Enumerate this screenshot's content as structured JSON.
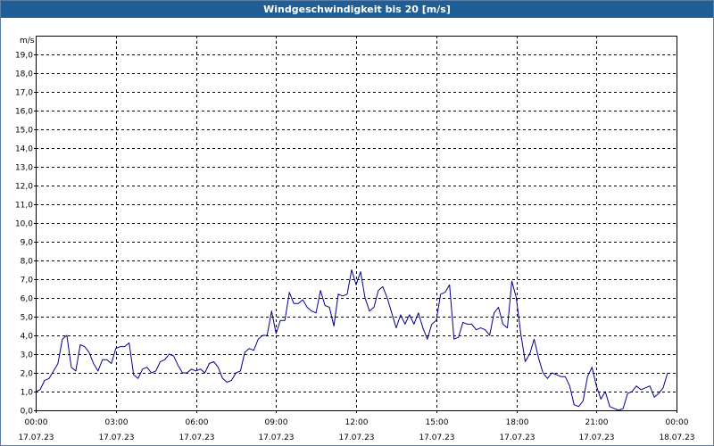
{
  "window": {
    "title": "Windgeschwindigkeit bis 20 [m/s]"
  },
  "chart_data": {
    "type": "line",
    "title": "Windgeschwindigkeit bis 20 [m/s]",
    "ylabel": "m/s",
    "xlabel": "",
    "ylim": [
      0,
      20
    ],
    "xlim_hours": [
      0,
      24
    ],
    "grid": true,
    "y_ticks": [
      "0,0",
      "1,0",
      "2,0",
      "3,0",
      "4,0",
      "5,0",
      "6,0",
      "7,0",
      "8,0",
      "9,0",
      "10,0",
      "11,0",
      "12,0",
      "13,0",
      "14,0",
      "15,0",
      "16,0",
      "17,0",
      "18,0",
      "19,0"
    ],
    "x_ticks": [
      {
        "time": "00:00",
        "date": "17.07.23"
      },
      {
        "time": "03:00",
        "date": "17.07.23"
      },
      {
        "time": "06:00",
        "date": "17.07.23"
      },
      {
        "time": "09:00",
        "date": "17.07.23"
      },
      {
        "time": "12:00",
        "date": "17.07.23"
      },
      {
        "time": "15:00",
        "date": "17.07.23"
      },
      {
        "time": "18:00",
        "date": "17.07.23"
      },
      {
        "time": "21:00",
        "date": "17.07.23"
      },
      {
        "time": "00:00",
        "date": "18.07.23"
      }
    ],
    "series": [
      {
        "color": "#00008b",
        "x_hours": [
          0,
          0.167,
          0.333,
          0.5,
          0.667,
          0.833,
          1,
          1.167,
          1.333,
          1.5,
          1.667,
          1.833,
          2,
          2.167,
          2.333,
          2.5,
          2.667,
          2.833,
          3,
          3.167,
          3.333,
          3.5,
          3.667,
          3.833,
          4,
          4.167,
          4.333,
          4.5,
          4.667,
          4.833,
          5,
          5.167,
          5.333,
          5.5,
          5.667,
          5.833,
          6,
          6.167,
          6.333,
          6.5,
          6.667,
          6.833,
          7,
          7.167,
          7.333,
          7.5,
          7.667,
          7.833,
          8,
          8.167,
          8.333,
          8.5,
          8.667,
          8.833,
          9,
          9.167,
          9.333,
          9.5,
          9.667,
          9.833,
          10,
          10.167,
          10.333,
          10.5,
          10.667,
          10.833,
          11,
          11.167,
          11.333,
          11.5,
          11.667,
          11.833,
          12,
          12.167,
          12.333,
          12.5,
          12.667,
          12.833,
          13,
          13.167,
          13.333,
          13.5,
          13.667,
          13.833,
          14,
          14.167,
          14.333,
          14.5,
          14.667,
          14.833,
          15,
          15.167,
          15.333,
          15.5,
          15.667,
          15.833,
          16,
          16.167,
          16.333,
          16.5,
          16.667,
          16.833,
          17,
          17.167,
          17.333,
          17.5,
          17.667,
          17.833,
          18,
          18.167,
          18.333,
          18.5,
          18.667,
          18.833,
          19,
          19.167,
          19.333,
          19.5,
          19.667,
          19.833,
          20,
          20.167,
          20.333,
          20.5,
          20.667,
          20.833,
          21,
          21.167,
          21.333,
          21.5,
          21.667,
          21.833,
          22,
          22.167,
          22.333,
          22.5,
          22.667,
          22.833,
          23,
          23.167,
          23.333,
          23.5,
          23.667,
          23.833
        ],
        "values": [
          1.0,
          1.1,
          1.6,
          1.7,
          2.1,
          2.5,
          3.8,
          4.0,
          2.3,
          2.1,
          3.5,
          3.4,
          3.1,
          2.5,
          2.1,
          2.7,
          2.7,
          2.5,
          3.3,
          3.4,
          3.4,
          3.6,
          1.9,
          1.7,
          2.2,
          2.3,
          2.0,
          2.1,
          2.6,
          2.7,
          3.0,
          2.9,
          2.4,
          2.0,
          2.0,
          2.2,
          2.1,
          2.2,
          2.0,
          2.5,
          2.6,
          2.3,
          1.7,
          1.5,
          1.6,
          2.0,
          2.1,
          3.1,
          3.3,
          3.2,
          3.8,
          4.0,
          4.0,
          5.3,
          4.1,
          4.8,
          4.8,
          6.3,
          5.7,
          5.7,
          5.9,
          5.5,
          5.3,
          5.2,
          6.4,
          5.6,
          5.5,
          4.5,
          6.2,
          6.1,
          6.2,
          7.5,
          6.7,
          7.4,
          6.0,
          5.3,
          5.5,
          6.4,
          6.6,
          6.0,
          5.2,
          4.4,
          5.1,
          4.6,
          5.1,
          4.6,
          5.2,
          4.4,
          3.8,
          4.6,
          4.8,
          6.2,
          6.3,
          6.7,
          3.8,
          3.9,
          4.7,
          4.6,
          4.6,
          4.3,
          4.4,
          4.3,
          4.0,
          5.2,
          5.5,
          4.6,
          4.4,
          6.9,
          6.0,
          4.1,
          2.6,
          3.0,
          3.8,
          2.8,
          2.0,
          1.7,
          2.0,
          1.9,
          1.8,
          1.8,
          1.3,
          0.3,
          0.2,
          0.5,
          1.8,
          2.3,
          1.3,
          0.6,
          1.0,
          0.2,
          0.1,
          0.0,
          0.1,
          0.9,
          1.0,
          1.3,
          1.1,
          1.2,
          1.3,
          0.7,
          0.9,
          1.2,
          2.0
        ]
      }
    ]
  }
}
